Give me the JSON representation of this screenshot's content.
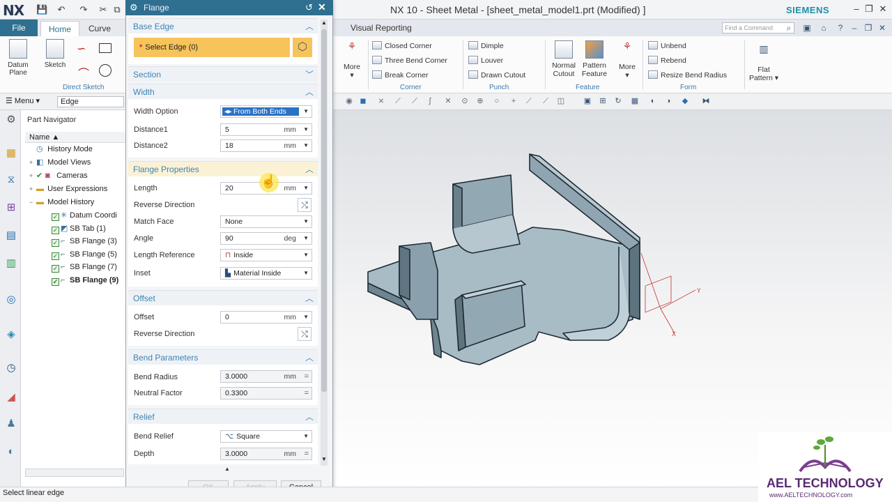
{
  "app": {
    "logo": "NX",
    "window_title": "NX 10 - Sheet Metal - [sheet_metal_model1.prt (Modified) ]",
    "brand": "SIEMENS"
  },
  "ribbon_left": {
    "tabs": [
      "File",
      "Home",
      "Curve"
    ],
    "datum_plane": "Datum Plane",
    "sketch": "Sketch",
    "group_direct_sketch": "Direct Sketch"
  },
  "menu_row": {
    "menu_label": "Menu",
    "selection_filter": "Edge"
  },
  "navigator": {
    "title": "Part Navigator",
    "column_name": "Name",
    "items": [
      {
        "label": "History Mode",
        "level": 0
      },
      {
        "label": "Model Views",
        "level": 0
      },
      {
        "label": "Cameras",
        "level": 0
      },
      {
        "label": "User Expressions",
        "level": 0
      },
      {
        "label": "Model History",
        "level": 0
      },
      {
        "label": "Datum Coordi",
        "level": 1
      },
      {
        "label": "SB Tab (1)",
        "level": 1
      },
      {
        "label": "SB Flange (3)",
        "level": 1
      },
      {
        "label": "SB Flange (5)",
        "level": 1
      },
      {
        "label": "SB Flange (7)",
        "level": 1
      },
      {
        "label": "SB Flange (9)",
        "level": 1
      }
    ]
  },
  "ribbon_right": {
    "tab": "Visual Reporting",
    "search_placeholder": "Find a Command",
    "more1": "More",
    "corner": {
      "items": [
        "Closed Corner",
        "Three Bend Corner",
        "Break Corner"
      ],
      "label": "Corner"
    },
    "punch": {
      "items": [
        "Dimple",
        "Louver",
        "Drawn Cutout"
      ],
      "label": "Punch"
    },
    "feature": {
      "normal_cutout": "Normal Cutout",
      "pattern_feature": "Pattern Feature",
      "more": "More",
      "label": "Feature"
    },
    "form": {
      "items": [
        "Unbend",
        "Rebend",
        "Resize Bend Radius"
      ],
      "label": "Form"
    },
    "flat_pattern": "Flat Pattern"
  },
  "dialog": {
    "title": "Flange",
    "base_edge": {
      "header": "Base Edge",
      "select_edge": "Select Edge (0)"
    },
    "section": {
      "header": "Section"
    },
    "width": {
      "header": "Width",
      "width_option_label": "Width Option",
      "width_option_value": "From Both Ends",
      "distance1_label": "Distance1",
      "distance1_value": "5",
      "distance1_unit": "mm",
      "distance2_label": "Distance2",
      "distance2_value": "18",
      "distance2_unit": "mm"
    },
    "flange_properties": {
      "header": "Flange Properties",
      "length_label": "Length",
      "length_value": "20",
      "length_unit": "mm",
      "reverse_direction_label": "Reverse Direction",
      "match_face_label": "Match Face",
      "match_face_value": "None",
      "angle_label": "Angle",
      "angle_value": "90",
      "angle_unit": "deg",
      "length_reference_label": "Length Reference",
      "length_reference_value": "Inside",
      "inset_label": "Inset",
      "inset_value": "Material Inside"
    },
    "offset": {
      "header": "Offset",
      "offset_label": "Offset",
      "offset_value": "0",
      "offset_unit": "mm",
      "reverse_direction_label": "Reverse Direction"
    },
    "bend_parameters": {
      "header": "Bend Parameters",
      "bend_radius_label": "Bend Radius",
      "bend_radius_value": "3.0000",
      "bend_radius_unit": "mm",
      "neutral_factor_label": "Neutral Factor",
      "neutral_factor_value": "0.3300"
    },
    "relief": {
      "header": "Relief",
      "bend_relief_label": "Bend Relief",
      "bend_relief_value": "Square",
      "depth_label": "Depth",
      "depth_value": "3.0000",
      "depth_unit": "mm"
    },
    "buttons": {
      "ok": "OK",
      "apply": "Apply",
      "cancel": "Cancel"
    }
  },
  "status": "Select linear edge",
  "logo": {
    "name": "AEL TECHNOLOGY",
    "url": "www.AELTECHNOLOGY.com"
  }
}
